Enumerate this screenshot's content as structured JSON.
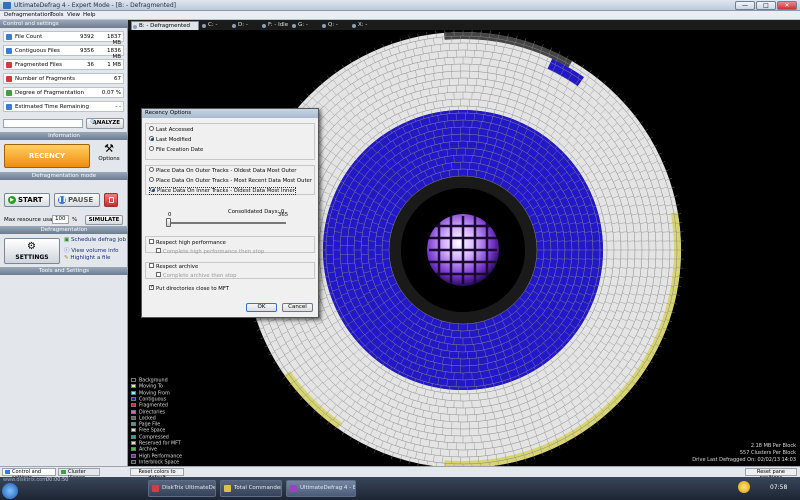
{
  "window": {
    "title": "UltimateDefrag 4 - Expert Mode - [B: - Defragmented]",
    "min_label": "—",
    "max_label": "□",
    "close_label": "✕"
  },
  "menu": [
    "Defragmentation",
    "Tools",
    "View",
    "Help"
  ],
  "panel": {
    "control_header": "Control and settings",
    "stats": [
      {
        "label": "File Count",
        "v1": "9392",
        "v2": "1837 MB",
        "icon": "#3a7bd5"
      },
      {
        "label": "Contiguous Files",
        "v1": "9356",
        "v2": "1836 MB",
        "icon": "#3a7bd5"
      },
      {
        "label": "Fragmented Files",
        "v1": "36",
        "v2": "1 MB",
        "icon": "#d23a3a"
      },
      {
        "label": "Number of Fragments",
        "v1": "",
        "v2": "67",
        "icon": "#d23a3a"
      },
      {
        "label": "Degree of Fragmentation",
        "v1": "",
        "v2": "0.07 %",
        "icon": "#40a040"
      },
      {
        "label": "Estimated Time Remaining",
        "v1": "",
        "v2": "- -",
        "icon": "#3a7bd5"
      }
    ],
    "analyze_label": "ANALYZE",
    "information_header": "Information",
    "mode_label": "RECENCY",
    "options_label": "Options",
    "mode_header": "Defragmentation mode",
    "start_label": "START",
    "pause_label": "PAUSE",
    "defrag_header": "Defragmentation",
    "max_resource_label": "Max resource usage:",
    "max_resource_value": "100",
    "percent": "%",
    "simulate_label": "SIMULATE",
    "settings_label": "SETTINGS",
    "tools": [
      "Schedule defrag job",
      "View volume info",
      "Highlight a file"
    ],
    "tools_header": "Tools and Settings"
  },
  "drive_tabs": [
    {
      "label": "B: - Defragmented",
      "active": true
    },
    {
      "label": "C: - Idle",
      "active": false
    },
    {
      "label": "D: - Idle",
      "active": false
    },
    {
      "label": "F: - Idle",
      "active": false
    },
    {
      "label": "G: - Idle",
      "active": false
    },
    {
      "label": "Q: - Idle",
      "active": false
    },
    {
      "label": "X: - Idle",
      "active": false
    }
  ],
  "dialog": {
    "title": "Recency Options",
    "radios_a": [
      {
        "label": "Last Accessed",
        "selected": false
      },
      {
        "label": "Last Modified",
        "selected": true
      },
      {
        "label": "File Creation Date",
        "selected": false
      }
    ],
    "radios_b": [
      {
        "label": "Place Data On Outer Tracks - Oldest Data Most Outer",
        "selected": false
      },
      {
        "label": "Place Data On Outer Tracks - Most Recent Data Most Outer",
        "selected": false
      },
      {
        "label": "Place Data On Inner Tracks - Oldest Data Most Inner",
        "selected": true
      }
    ],
    "slider_min": "0",
    "slider_max": "365",
    "slider_caption": "Consolidated Days: 0",
    "slider_value_days": 0,
    "respect_perf": "Respect high performance",
    "complete_perf": "Complete high performance then stop",
    "respect_archive": "Respect archive",
    "complete_archive": "Complete archive then stop",
    "put_dirs": "Put directories close to MFT",
    "ok_label": "OK",
    "cancel_label": "Cancel"
  },
  "legend": [
    {
      "label": "Background",
      "color": "#000000"
    },
    {
      "label": "Moving To",
      "color": "#f0f080"
    },
    {
      "label": "Moving From",
      "color": "#80ffff"
    },
    {
      "label": "Contiguous",
      "color": "#2020d0"
    },
    {
      "label": "Fragmented",
      "color": "#e02020"
    },
    {
      "label": "Directories",
      "color": "#e060e0"
    },
    {
      "label": "Locked",
      "color": "#606060"
    },
    {
      "label": "Page File",
      "color": "#40a0a0"
    },
    {
      "label": "Free Space",
      "color": "#e0e0e0"
    },
    {
      "label": "Compressed",
      "color": "#20a0a0"
    },
    {
      "label": "Reserved for MFT",
      "color": "#e8e0a0"
    },
    {
      "label": "Archive",
      "color": "#40c040"
    },
    {
      "label": "High Performance",
      "color": "#8020c0"
    },
    {
      "label": "Interblock Space",
      "color": "#202020"
    }
  ],
  "block_info": {
    "mb_per_block": "2.18 MB Per Block",
    "clusters_per_block": "557 Clusters Per Block",
    "last_defragged": "Drive Last Defragged On: 02/02/13 14:03"
  },
  "bottom": {
    "tab_control": "Control and settings",
    "tab_cluster": "Cluster Viewer",
    "reset_colors": "Reset colors to default",
    "reset_panes": "Reset pane positions",
    "site": "www.disktrix.com",
    "timer": "00:00:50"
  },
  "taskbar": {
    "items": [
      {
        "label": "DiskTrix UltimateDefr...",
        "color": "#d04040"
      },
      {
        "label": "Total Commander (x...",
        "color": "#e0c040"
      },
      {
        "label": "UltimateDefrag 4 - Ex...",
        "color": "#a040c0"
      }
    ],
    "clock": "07:58"
  },
  "colors": {
    "free": "#e4e4e4",
    "contiguous": "#2218c8",
    "mft": "#d8d470",
    "grid": "#8a8a8a"
  }
}
